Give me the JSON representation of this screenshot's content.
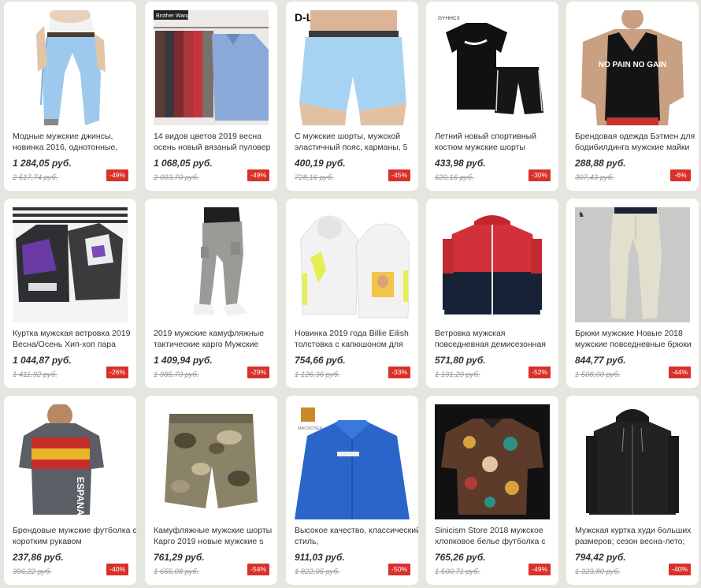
{
  "products": [
    {
      "title": "Модные мужские джинсы, новинка 2016, однотонные,",
      "price": "1 284,05 руб.",
      "old_price": "2 517,74 руб.",
      "discount": "-49%",
      "image_icon": "jeans-icon"
    },
    {
      "title": "14 видов цветов 2019 весна осень новый вязаный пуловер",
      "price": "1 068,05 руб.",
      "old_price": "2 093,70 руб.",
      "discount": "-49%",
      "image_icon": "sweater-icon",
      "image_text": "Brother Wang"
    },
    {
      "title": "С мужские шорты, мужской эластичный пояс, карманы, 5",
      "price": "400,19 руб.",
      "old_price": "728,16 руб.",
      "discount": "-45%",
      "image_icon": "shorts-icon",
      "image_text": "D-LVS"
    },
    {
      "title": "Летний новый спортивный костюм мужские шорты",
      "price": "433,98 руб.",
      "old_price": "620,16 руб.",
      "discount": "-30%",
      "image_icon": "tracksuit-icon",
      "image_text": "GYHHCX"
    },
    {
      "title": "Брендовая одежда Бэтмен для бодибилдинга мужские майки",
      "price": "288,88 руб.",
      "old_price": "307,43 руб.",
      "discount": "-6%",
      "image_icon": "tank-top-icon",
      "image_text": "NO PAIN NO GAIN"
    },
    {
      "title": "Куртка мужская ветровка 2019 Весна/Осень Хип-хоп пара",
      "price": "1 044,87 руб.",
      "old_price": "1 411,92 руб.",
      "discount": "-26%",
      "image_icon": "jacket-icon"
    },
    {
      "title": "2019 мужские камуфляжные тактические карго Мужские",
      "price": "1 409,94 руб.",
      "old_price": "1 985,70 руб.",
      "discount": "-29%",
      "image_icon": "cargo-pants-icon"
    },
    {
      "title": "Новинка 2019 года Billie Eilish толстовка с капюшоном для",
      "price": "754,66 руб.",
      "old_price": "1 126,36 руб.",
      "discount": "-33%",
      "image_icon": "hoodie-icon"
    },
    {
      "title": "Ветровка мужская повседневная демисезонная",
      "price": "571,80 руб.",
      "old_price": "1 191,29 руб.",
      "discount": "-52%",
      "image_icon": "windbreaker-icon"
    },
    {
      "title": "Брюки мужские Новые 2018 мужские повседневные брюки",
      "price": "844,77 руб.",
      "old_price": "1 508,00 руб.",
      "discount": "-44%",
      "image_icon": "chinos-icon"
    },
    {
      "title": "Брендовые мужские футболка с коротким рукавом",
      "price": "237,86 руб.",
      "old_price": "396,22 руб.",
      "discount": "-40%",
      "image_icon": "tshirt-icon",
      "image_text": "ESPANA"
    },
    {
      "title": "Камуфляжные мужские шорты Карго 2019 новые мужские s",
      "price": "761,29 руб.",
      "old_price": "1 655,08 руб.",
      "discount": "-54%",
      "image_icon": "camo-shorts-icon"
    },
    {
      "title": "Высокое качество, классический стиль,",
      "price": "911,03 руб.",
      "old_price": "1 822,05 руб.",
      "discount": "-50%",
      "image_icon": "shirt-icon",
      "image_text": "MACROSEA"
    },
    {
      "title": "Sinicism Store 2018 мужское хлопковое белье футболка с",
      "price": "765,26 руб.",
      "old_price": "1 500,71 руб.",
      "discount": "-49%",
      "image_icon": "print-shirt-icon"
    },
    {
      "title": "Мужская куртка худи больших размеров; сезон весна-лето;",
      "price": "794,42 руб.",
      "old_price": "1 323,80 руб.",
      "discount": "-40%",
      "image_icon": "zip-hoodie-icon"
    }
  ],
  "colors": {
    "background": "#e6e6e0",
    "card": "#ffffff",
    "discount_badge": "#d9312a",
    "price": "#333333",
    "old_price": "#999999"
  }
}
